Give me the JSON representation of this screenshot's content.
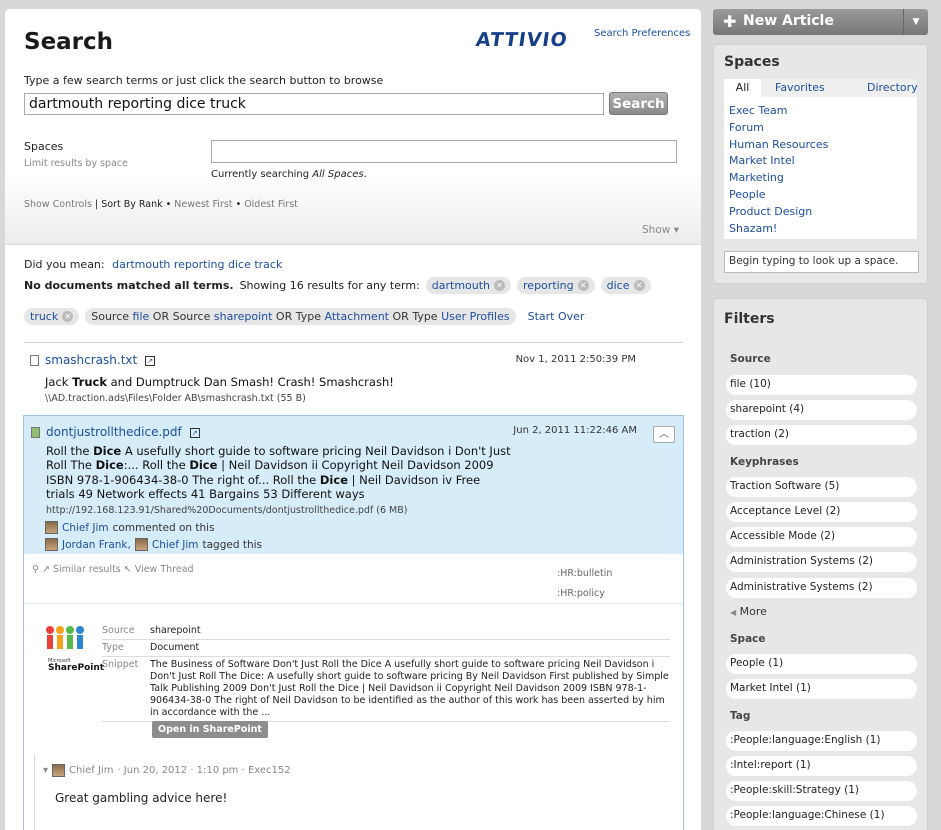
{
  "header": {
    "title": "Search",
    "logo": "ATTIVIO",
    "prefs": "Search Preferences",
    "hint": "Type a few search terms or just click the search button to browse",
    "query": "dartmouth reporting dice truck",
    "search_button": "Search",
    "spaces_label": "Spaces",
    "spaces_sub": "Limit results by space",
    "current_prefix": "Currently searching ",
    "current_value": "All Spaces",
    "current_suffix": ".",
    "show_controls": "Show Controls",
    "sort_by": "Sort By Rank",
    "newest": "Newest First",
    "oldest": "Oldest First",
    "show": "Show"
  },
  "suggest": {
    "did_you_mean": "Did you mean:",
    "suggestion": "dartmouth reporting dice track",
    "no_docs": "No documents matched all terms.",
    "showing": "Showing 16 results for any term:",
    "terms": [
      "dartmouth",
      "reporting",
      "dice",
      "truck"
    ],
    "criteria": {
      "source": "Source",
      "file": "file",
      "or1": "OR",
      "source2": "Source",
      "sharepoint": "sharepoint",
      "or2": "OR",
      "type": "Type",
      "attachment": "Attachment",
      "or3": "OR",
      "type2": "Type",
      "userprofiles": "User Profiles"
    },
    "start_over": "Start Over"
  },
  "result1": {
    "title": "smashcrash.txt",
    "date": "Nov 1, 2011 2:50:39 PM",
    "desc_pre": "Jack ",
    "desc_bold": "Truck",
    "desc_post": " and Dumptruck Dan Smash! Crash! Smashcrash!",
    "path": "\\\\AD.traction.ads\\Files\\Folder AB\\smashcrash.txt (55 B)"
  },
  "result2": {
    "title": "dontjustrollthedice.pdf",
    "date": "Jun 2, 2011 11:22:46 AM",
    "l1a": "Roll the ",
    "l1b": "Dice",
    "l1c": " A usefully short guide to software pricing Neil Davidson i Don't Just",
    "l2a": "Roll The ",
    "l2b": "Dice",
    "l2c": ":... Roll the ",
    "l2d": "Dice",
    "l2e": " | Neil Davidson ii Copyright Neil Davidson 2009",
    "l3a": "ISBN 978-1-906434-38-0 The right of... Roll the ",
    "l3b": "Dice",
    "l3c": " | Neil Davidson iv Free",
    "l4": "trials 49 Network effects 41 Bargains 53 Different ways",
    "path": "http://192.168.123.91/Shared%20Documents/dontjustrollthedice.pdf (6 MB)",
    "comment_user": "Chief Jim",
    "comment_text": "commented on this",
    "tag_user1": "Jordan Frank,",
    "tag_user2": "Chief Jim",
    "tag_text": "tagged this",
    "similar": "Similar results",
    "view_thread": "View Thread",
    "tags": [
      ":HR:bulletin",
      ":HR:policy"
    ],
    "sp_logo_small": "Microsoft",
    "sp_logo": "SharePoint",
    "details": [
      {
        "k": "Source",
        "v": "sharepoint"
      },
      {
        "k": "Type",
        "v": "Document"
      },
      {
        "k": "Snippet",
        "v": "The Business of Software Don't Just Roll the Dice A usefully short guide to software pricing Neil Davidson i Don't Just Roll The Dice: A usefully short guide to software pricing By Neil Davidson First published by Simple Talk Publishing 2009 Don't Just Roll the Dice | Neil Davidson ii Copyright Neil Davidson 2009 ISBN 978-1-906434-38-0 The right of Neil Davidson to be identified as the author of this work has been asserted by him in accordance with the ..."
      }
    ],
    "open_btn": "Open in SharePoint",
    "comment_meta_user": "Chief Jim",
    "comment_meta_rest": "· Jun 20, 2012 · 1:10 pm · Exec152",
    "comment_body": "Great gambling advice here!"
  },
  "sidebar": {
    "new_article": "New Article",
    "spaces_title": "Spaces",
    "tab_all": "All",
    "tab_fav": "Favorites",
    "tab_dir": "Directory",
    "spaces": [
      "Exec Team",
      "Forum",
      "Human Resources",
      "Market Intel",
      "Marketing",
      "People",
      "Product Design",
      "Shazam!"
    ],
    "lookup": "Begin typing to look up a space.",
    "filters_title": "Filters",
    "source_label": "Source",
    "sources": [
      "file (10)",
      "sharepoint (4)",
      "traction (2)"
    ],
    "keyphrases_label": "Keyphrases",
    "keyphrases": [
      "Traction Software (5)",
      "Acceptance Level (2)",
      "Accessible Mode (2)",
      "Administration Systems (2)",
      "Administrative Systems (2)"
    ],
    "more": "More",
    "space_label": "Space",
    "space_items": [
      "People (1)",
      "Market Intel (1)"
    ],
    "tag_label": "Tag",
    "tag_items": [
      ":People:language:English (1)",
      ":Intel:report (1)",
      ":People:skill:Strategy (1)",
      ":People:language:Chinese (1)"
    ]
  }
}
